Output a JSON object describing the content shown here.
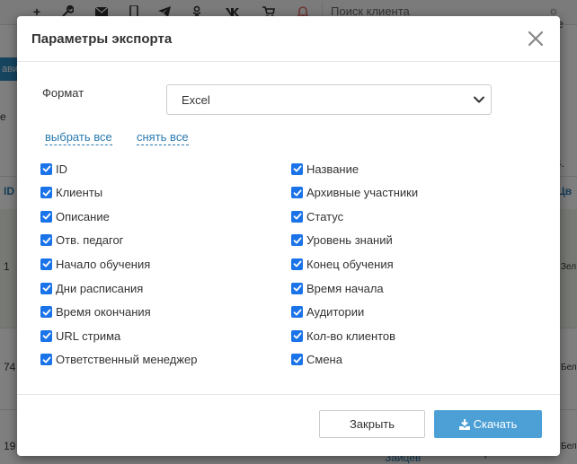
{
  "background": {
    "search_placeholder": "Поиск клиента",
    "side_button_label": "авит",
    "col_id_header": "ID",
    "row_num_1": "1",
    "row_num_2": "74",
    "row_num_3": "19",
    "right_fragment_4": "4.",
    "right_header_fragment": "Цв",
    "right_cell_1": "Зел",
    "right_cell_2": "Бел",
    "right_cell_3": "Бел",
    "bottom_name_1": "Марьевна",
    "bottom_name_2": "Зайцев"
  },
  "modal": {
    "title": "Параметры экспорта",
    "format_label": "Формат",
    "format_value": "Excel",
    "select_all": "выбрать все",
    "deselect_all": "снять все",
    "fields_left": [
      "ID",
      "Клиенты",
      "Описание",
      "Отв. педагог",
      "Начало обучения",
      "Дни расписания",
      "Время окончания",
      "URL стрима",
      "Ответственный менеджер"
    ],
    "fields_right": [
      "Название",
      "Архивные участники",
      "Статус",
      "Уровень знаний",
      "Конец обучения",
      "Время начала",
      "Аудитории",
      "Кол-во клиентов",
      "Смена"
    ],
    "close_label": "Закрыть",
    "download_label": "Скачать"
  },
  "colors": {
    "accent": "#4da0d6",
    "checkbox": "#1a73e8",
    "link": "#2a7ab0"
  }
}
